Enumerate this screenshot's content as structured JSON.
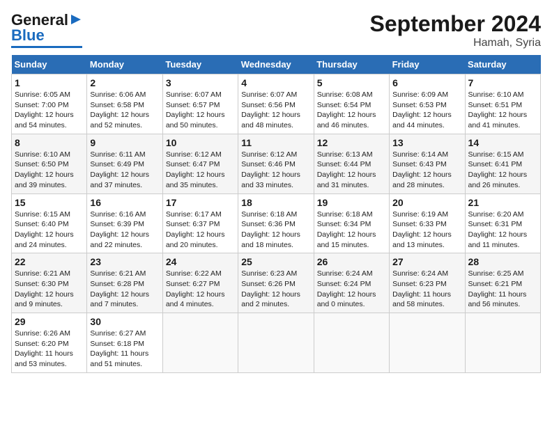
{
  "header": {
    "logo_general": "General",
    "logo_blue": "Blue",
    "title": "September 2024",
    "subtitle": "Hamah, Syria"
  },
  "weekdays": [
    "Sunday",
    "Monday",
    "Tuesday",
    "Wednesday",
    "Thursday",
    "Friday",
    "Saturday"
  ],
  "weeks": [
    [
      {
        "day": "1",
        "sunrise": "Sunrise: 6:05 AM",
        "sunset": "Sunset: 7:00 PM",
        "daylight": "Daylight: 12 hours and 54 minutes."
      },
      {
        "day": "2",
        "sunrise": "Sunrise: 6:06 AM",
        "sunset": "Sunset: 6:58 PM",
        "daylight": "Daylight: 12 hours and 52 minutes."
      },
      {
        "day": "3",
        "sunrise": "Sunrise: 6:07 AM",
        "sunset": "Sunset: 6:57 PM",
        "daylight": "Daylight: 12 hours and 50 minutes."
      },
      {
        "day": "4",
        "sunrise": "Sunrise: 6:07 AM",
        "sunset": "Sunset: 6:56 PM",
        "daylight": "Daylight: 12 hours and 48 minutes."
      },
      {
        "day": "5",
        "sunrise": "Sunrise: 6:08 AM",
        "sunset": "Sunset: 6:54 PM",
        "daylight": "Daylight: 12 hours and 46 minutes."
      },
      {
        "day": "6",
        "sunrise": "Sunrise: 6:09 AM",
        "sunset": "Sunset: 6:53 PM",
        "daylight": "Daylight: 12 hours and 44 minutes."
      },
      {
        "day": "7",
        "sunrise": "Sunrise: 6:10 AM",
        "sunset": "Sunset: 6:51 PM",
        "daylight": "Daylight: 12 hours and 41 minutes."
      }
    ],
    [
      {
        "day": "8",
        "sunrise": "Sunrise: 6:10 AM",
        "sunset": "Sunset: 6:50 PM",
        "daylight": "Daylight: 12 hours and 39 minutes."
      },
      {
        "day": "9",
        "sunrise": "Sunrise: 6:11 AM",
        "sunset": "Sunset: 6:49 PM",
        "daylight": "Daylight: 12 hours and 37 minutes."
      },
      {
        "day": "10",
        "sunrise": "Sunrise: 6:12 AM",
        "sunset": "Sunset: 6:47 PM",
        "daylight": "Daylight: 12 hours and 35 minutes."
      },
      {
        "day": "11",
        "sunrise": "Sunrise: 6:12 AM",
        "sunset": "Sunset: 6:46 PM",
        "daylight": "Daylight: 12 hours and 33 minutes."
      },
      {
        "day": "12",
        "sunrise": "Sunrise: 6:13 AM",
        "sunset": "Sunset: 6:44 PM",
        "daylight": "Daylight: 12 hours and 31 minutes."
      },
      {
        "day": "13",
        "sunrise": "Sunrise: 6:14 AM",
        "sunset": "Sunset: 6:43 PM",
        "daylight": "Daylight: 12 hours and 28 minutes."
      },
      {
        "day": "14",
        "sunrise": "Sunrise: 6:15 AM",
        "sunset": "Sunset: 6:41 PM",
        "daylight": "Daylight: 12 hours and 26 minutes."
      }
    ],
    [
      {
        "day": "15",
        "sunrise": "Sunrise: 6:15 AM",
        "sunset": "Sunset: 6:40 PM",
        "daylight": "Daylight: 12 hours and 24 minutes."
      },
      {
        "day": "16",
        "sunrise": "Sunrise: 6:16 AM",
        "sunset": "Sunset: 6:39 PM",
        "daylight": "Daylight: 12 hours and 22 minutes."
      },
      {
        "day": "17",
        "sunrise": "Sunrise: 6:17 AM",
        "sunset": "Sunset: 6:37 PM",
        "daylight": "Daylight: 12 hours and 20 minutes."
      },
      {
        "day": "18",
        "sunrise": "Sunrise: 6:18 AM",
        "sunset": "Sunset: 6:36 PM",
        "daylight": "Daylight: 12 hours and 18 minutes."
      },
      {
        "day": "19",
        "sunrise": "Sunrise: 6:18 AM",
        "sunset": "Sunset: 6:34 PM",
        "daylight": "Daylight: 12 hours and 15 minutes."
      },
      {
        "day": "20",
        "sunrise": "Sunrise: 6:19 AM",
        "sunset": "Sunset: 6:33 PM",
        "daylight": "Daylight: 12 hours and 13 minutes."
      },
      {
        "day": "21",
        "sunrise": "Sunrise: 6:20 AM",
        "sunset": "Sunset: 6:31 PM",
        "daylight": "Daylight: 12 hours and 11 minutes."
      }
    ],
    [
      {
        "day": "22",
        "sunrise": "Sunrise: 6:21 AM",
        "sunset": "Sunset: 6:30 PM",
        "daylight": "Daylight: 12 hours and 9 minutes."
      },
      {
        "day": "23",
        "sunrise": "Sunrise: 6:21 AM",
        "sunset": "Sunset: 6:28 PM",
        "daylight": "Daylight: 12 hours and 7 minutes."
      },
      {
        "day": "24",
        "sunrise": "Sunrise: 6:22 AM",
        "sunset": "Sunset: 6:27 PM",
        "daylight": "Daylight: 12 hours and 4 minutes."
      },
      {
        "day": "25",
        "sunrise": "Sunrise: 6:23 AM",
        "sunset": "Sunset: 6:26 PM",
        "daylight": "Daylight: 12 hours and 2 minutes."
      },
      {
        "day": "26",
        "sunrise": "Sunrise: 6:24 AM",
        "sunset": "Sunset: 6:24 PM",
        "daylight": "Daylight: 12 hours and 0 minutes."
      },
      {
        "day": "27",
        "sunrise": "Sunrise: 6:24 AM",
        "sunset": "Sunset: 6:23 PM",
        "daylight": "Daylight: 11 hours and 58 minutes."
      },
      {
        "day": "28",
        "sunrise": "Sunrise: 6:25 AM",
        "sunset": "Sunset: 6:21 PM",
        "daylight": "Daylight: 11 hours and 56 minutes."
      }
    ],
    [
      {
        "day": "29",
        "sunrise": "Sunrise: 6:26 AM",
        "sunset": "Sunset: 6:20 PM",
        "daylight": "Daylight: 11 hours and 53 minutes."
      },
      {
        "day": "30",
        "sunrise": "Sunrise: 6:27 AM",
        "sunset": "Sunset: 6:18 PM",
        "daylight": "Daylight: 11 hours and 51 minutes."
      },
      null,
      null,
      null,
      null,
      null
    ]
  ]
}
